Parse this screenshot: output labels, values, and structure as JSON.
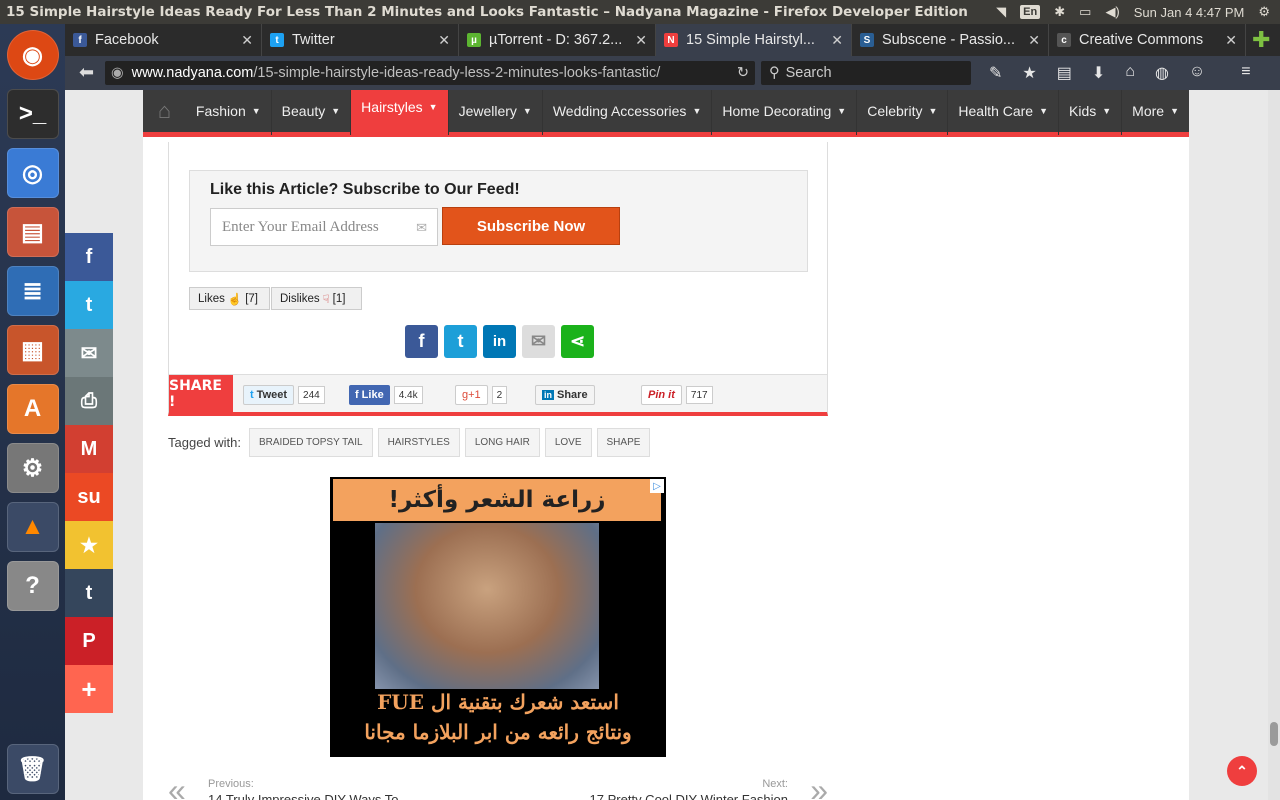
{
  "window": {
    "title": "15 Simple Hairstyle Ideas Ready For Less Than 2 Minutes and Looks Fantastic – Nadyana Magazine - Firefox Developer Edition"
  },
  "tray": {
    "lang": "En",
    "datetime": "Sun Jan  4  4:47 PM"
  },
  "tabs": [
    {
      "label": "Facebook",
      "fav": "f",
      "fav_color": "#3b5998"
    },
    {
      "label": "Twitter",
      "fav": "t",
      "fav_color": "#1da1f2"
    },
    {
      "label": "µTorrent - D: 367.2...",
      "fav": "µ",
      "fav_color": "#5cb531"
    },
    {
      "label": "15 Simple Hairstyl...",
      "fav": "N",
      "fav_color": "#ef3e3e"
    },
    {
      "label": "Subscene - Passio...",
      "fav": "S",
      "fav_color": "#2a5e93"
    },
    {
      "label": "Creative Commons",
      "fav": "cc",
      "fav_color": "#555"
    }
  ],
  "urlbar": {
    "host": "www.nadyana.com",
    "path": "/15-simple-hairstyle-ideas-ready-less-2-minutes-looks-fantastic/",
    "search_placeholder": "Search"
  },
  "nav": {
    "items": [
      "Fashion",
      "Beauty",
      "Hairstyles",
      "Jewellery",
      "Wedding Accessories",
      "Home Decorating",
      "Celebrity",
      "Health Care",
      "Kids",
      "More"
    ],
    "active": "Hairstyles"
  },
  "subscribe": {
    "heading": "Like this Article? Subscribe to Our Feed!",
    "email_placeholder": "Enter Your Email Address",
    "button": "Subscribe Now"
  },
  "votes": {
    "likes_label": "Likes",
    "likes_count": "[7]",
    "dislikes_label": "Dislikes",
    "dislikes_count": "[1]"
  },
  "share": {
    "label": "SHARE !",
    "tweet": "Tweet",
    "tweet_count": "244",
    "like": "Like",
    "like_count": "4.4k",
    "gplus": "g+1",
    "gplus_count": "2",
    "linkedin": "Share",
    "pinit": "Pin it",
    "pin_count": "717"
  },
  "tags": {
    "label": "Tagged with:",
    "items": [
      "BRAIDED TOPSY TAIL",
      "HAIRSTYLES",
      "LONG HAIR",
      "LOVE",
      "SHAPE"
    ]
  },
  "ad": {
    "headline": "زراعة الشعر وأكثر!",
    "line1": "استعد شعرك بتقنية ال FUE",
    "line2": "ونتائج رائعه من ابر البلازما مجانا"
  },
  "pagination": {
    "prev_label": "Previous:",
    "prev_title": "14 Truly Impressive DIY Ways To",
    "next_label": "Next:",
    "next_title": "17 Pretty Cool DIY Winter Fashion"
  }
}
